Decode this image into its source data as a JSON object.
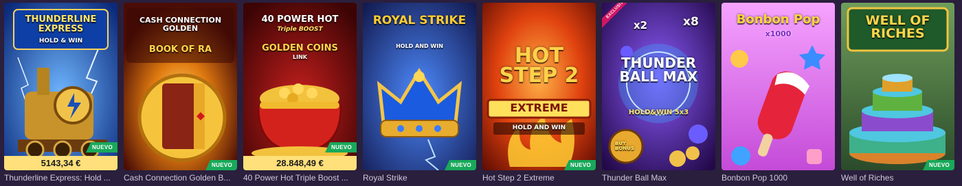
{
  "badge_new": "NUEVO",
  "games": [
    {
      "name": "Thunderline Express: Hold ...",
      "art_title": "THUNDERLINE EXPRESS",
      "art_sub": "HOLD & WIN",
      "jackpot": "5143,34 €",
      "is_new": true,
      "icon": "train-icon"
    },
    {
      "name": "Cash Connection Golden B...",
      "art_title": "CASH CONNECTION GOLDEN",
      "art_sub": "BOOK OF RA",
      "is_new": true,
      "icon": "book-icon"
    },
    {
      "name": "40 Power Hot Triple Boost ...",
      "art_title": "40 POWER HOT",
      "art_sub": "Triple BOOST",
      "art_sub2": "GOLDEN COINS",
      "art_sub3": "LINK",
      "jackpot": "28.848,49 €",
      "is_new": true,
      "icon": "coin-pot-icon"
    },
    {
      "name": "Royal Strike",
      "art_title": "ROYAL STRIKE",
      "art_sub": "HOLD AND WIN",
      "is_new": true,
      "icon": "crown-icon"
    },
    {
      "name": "Hot Step 2 Extreme",
      "art_title": "HOT STEP 2",
      "art_sub": "EXTREME",
      "art_sub2": "HOLD AND WIN",
      "is_new": true,
      "icon": "flame-icon"
    },
    {
      "name": "Thunder Ball Max",
      "art_title": "THUNDER BALL MAX",
      "art_sub": "HOLD&WIN 5x3",
      "art_tag": "EXCLUSIVE",
      "art_x2": "x2",
      "art_x8": "x8",
      "art_buy": "BUY BONUS",
      "is_new": false,
      "icon": "thunder-ball-icon"
    },
    {
      "name": "Bonbon Pop 1000",
      "art_title": "Bonbon Pop",
      "art_sub": "x1000",
      "is_new": false,
      "icon": "popsicle-icon"
    },
    {
      "name": "Well of Riches",
      "art_title": "WELL OF RICHES",
      "is_new": true,
      "icon": "fountain-icon"
    }
  ],
  "colors": {
    "page_bg": "#2a1f3d",
    "new_badge": "#19a95a",
    "jackpot_bar": "#ffe07a"
  }
}
